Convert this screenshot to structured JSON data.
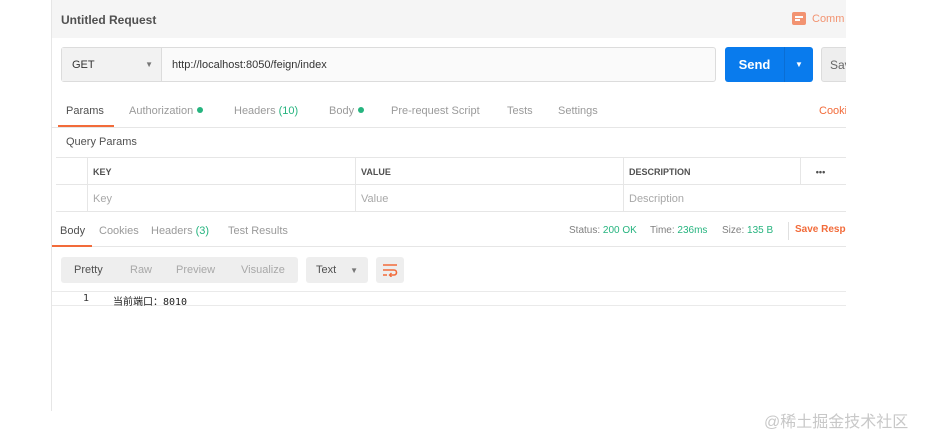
{
  "request": {
    "title": "Untitled Request",
    "comments_label": "Comm",
    "method": "GET",
    "url": "http://localhost:8050/feign/index",
    "send_label": "Send",
    "save_label": "Sav"
  },
  "request_tabs": [
    {
      "label": "Params",
      "active": true
    },
    {
      "label": "Authorization",
      "dot": true
    },
    {
      "label": "Headers",
      "count": "(10)"
    },
    {
      "label": "Body",
      "dot": true
    },
    {
      "label": "Pre-request Script"
    },
    {
      "label": "Tests"
    },
    {
      "label": "Settings"
    }
  ],
  "cookies_label": "Cooki",
  "query_params": {
    "label": "Query Params",
    "columns": [
      "KEY",
      "VALUE",
      "DESCRIPTION"
    ],
    "more": "•••",
    "placeholders": [
      "Key",
      "Value",
      "Description"
    ]
  },
  "response_tabs": [
    {
      "label": "Body",
      "active": true
    },
    {
      "label": "Cookies"
    },
    {
      "label": "Headers",
      "count": "(3)"
    },
    {
      "label": "Test Results"
    }
  ],
  "status": {
    "status_label": "Status:",
    "status_value": "200 OK",
    "time_label": "Time:",
    "time_value": "236ms",
    "size_label": "Size:",
    "size_value": "135 B",
    "save_response": "Save Resp"
  },
  "view_modes": [
    "Pretty",
    "Raw",
    "Preview",
    "Visualize"
  ],
  "format": "Text",
  "response_body": {
    "line_number": "1",
    "content": "当前端口：8010"
  },
  "watermark": "@稀土掘金技术社区",
  "colors": {
    "accent": "#f26b3a",
    "send": "#097bed",
    "success": "#26b47f"
  }
}
